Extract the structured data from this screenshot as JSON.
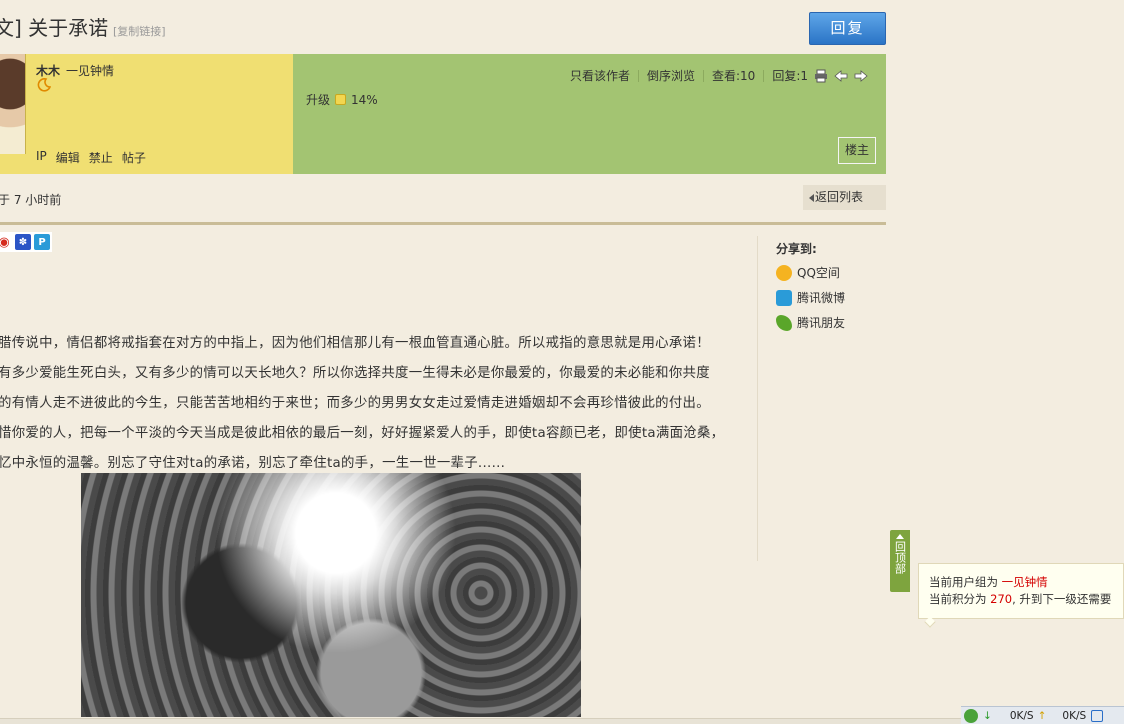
{
  "thread": {
    "title": "文] 关于承诺",
    "copy_link": "[复制链接]",
    "reply_label": "回复"
  },
  "author": {
    "name": "木木",
    "title": "一见钟情",
    "actions": [
      "IP",
      "编辑",
      "禁止",
      "帖子"
    ],
    "level_label": "升级",
    "level_percent": "14%",
    "floor_badge": "楼主"
  },
  "post_tools": {
    "only_author": "只看该作者",
    "reverse": "倒序浏览",
    "views": "查看:10",
    "replies": "回复:1"
  },
  "posted_time": "于 7 小时前",
  "back_to_list": "返回列表",
  "share": {
    "title": "分享到:",
    "items": [
      {
        "label": "QQ空间",
        "icon": "qzone-icon",
        "color": "#f5b321"
      },
      {
        "label": "腾讯微博",
        "icon": "tencent-weibo-icon",
        "color": "#2a9bd8"
      },
      {
        "label": "腾讯朋友",
        "icon": "tencent-friend-icon",
        "color": "#5aa62a"
      }
    ]
  },
  "post_body": {
    "lines": [
      "腊传说中，情侣都将戒指套在对方的中指上，因为他们相信那儿有一根血管直通心脏。所以戒指的意思就是用心承诺！",
      "有多少爱能生死白头，又有多少的情可以天长地久？所以你选择共度一生得未必是你最爱的，你最爱的未必能和你共度",
      "的有情人走不进彼此的今生，只能苦苦地相约于来世；而多少的男男女女走过爱情走进婚姻却不会再珍惜彼此的付出。",
      "惜你爱的人，把每一个平淡的今天当成是彼此相依的最后一刻，好好握紧爱人的手，即使ta容颜已老，即使ta满面沧桑，",
      "忆中永恒的温馨。别忘了守住对ta的承诺，别忘了牵住ta的手，一生一世一辈子......"
    ]
  },
  "back_top": "回顶部",
  "tooltip": {
    "line1_prefix": "当前用户组为 ",
    "line1_value": "一见钟情",
    "line2_prefix": "当前积分为 ",
    "line2_value": "270",
    "line2_suffix": ", 升到下一级还需要"
  },
  "status_bar": {
    "down_speed": "0K/S",
    "up_speed": "0K/S"
  }
}
